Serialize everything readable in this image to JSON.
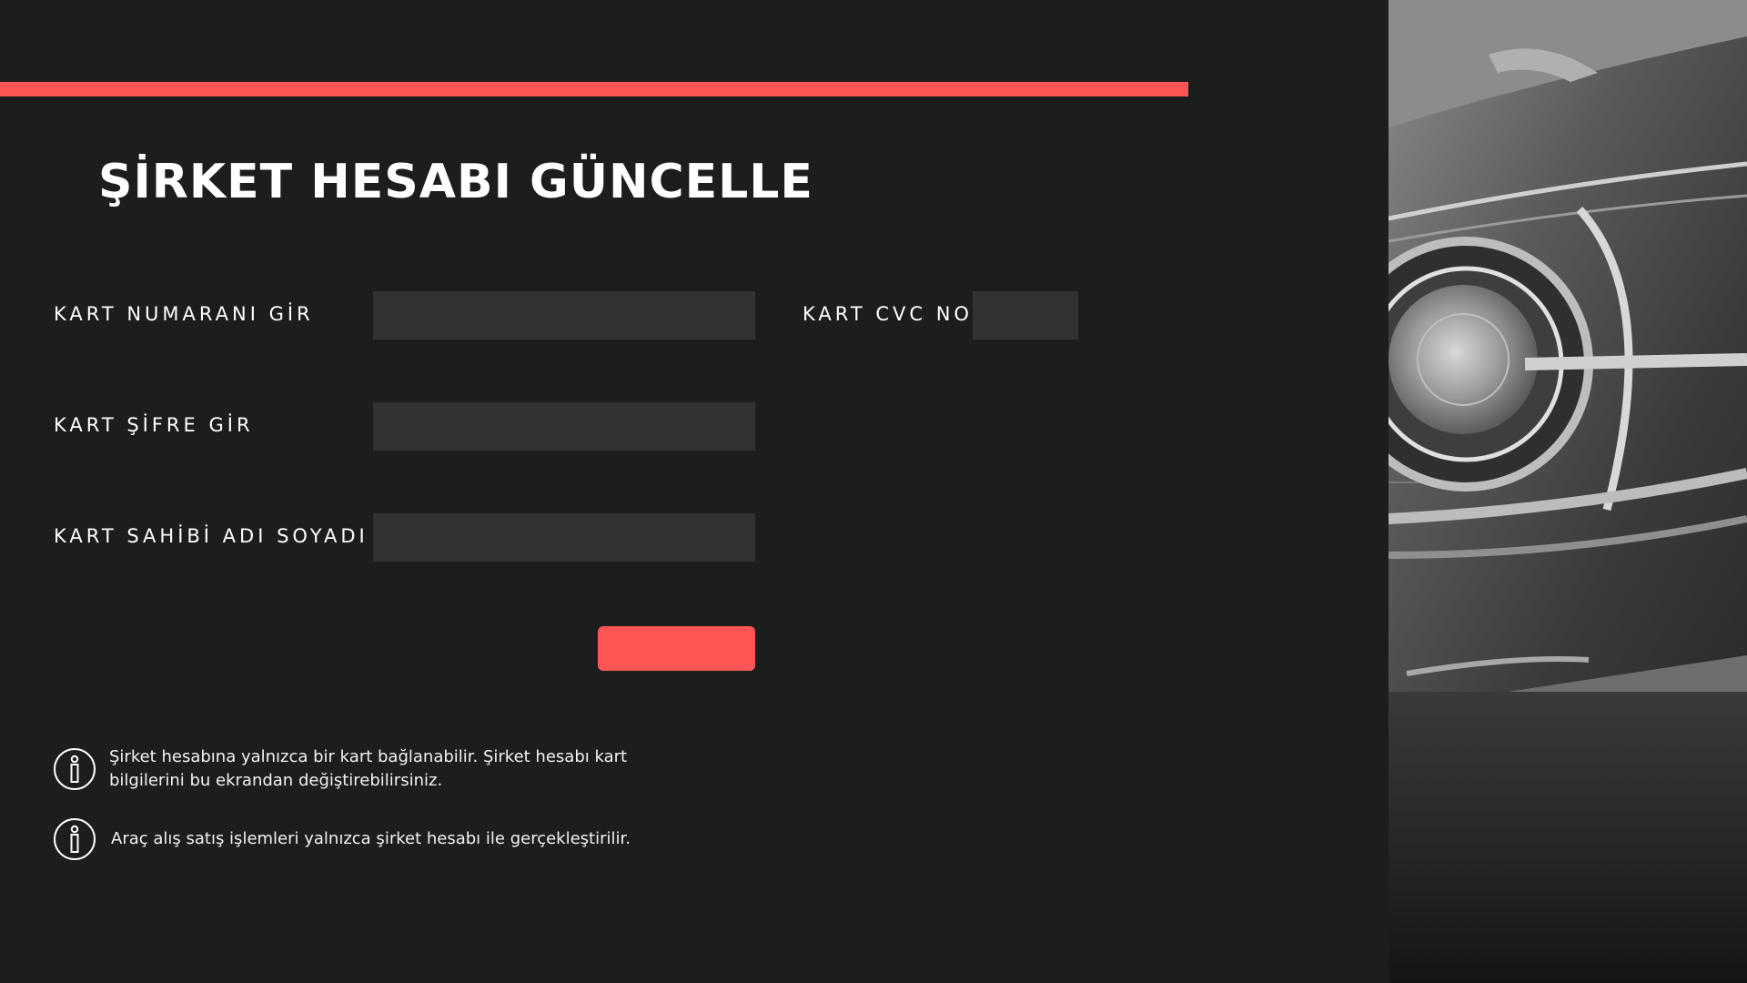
{
  "theme": {
    "accent": "#ff5555",
    "background": "#1c1e1e",
    "input_background": "#323232"
  },
  "form": {
    "title": "ŞİRKET HESABI GÜNCELLE",
    "card_number_label": "KART NUMARANI GİR",
    "card_number_value": "",
    "cvc_label": "KART CVC NO",
    "cvc_value": "",
    "password_label": "KART ŞİFRE GİR",
    "password_value": "",
    "holder_label": "KART SAHİBİ ADI SOYADI",
    "holder_value": "",
    "submit_label": ""
  },
  "info": {
    "icon": "info-icon",
    "messages": [
      "Şirket hesabına yalnızca bir kart bağlanabilir. Şirket hesabı kart bilgilerini bu ekrandan değiştirebilirsiniz.",
      "Araç alış satış işlemleri yalnızca şirket hesabı ile gerçekleştirilir."
    ]
  },
  "side_image": {
    "subject": "classic-car-headlight-photo"
  }
}
